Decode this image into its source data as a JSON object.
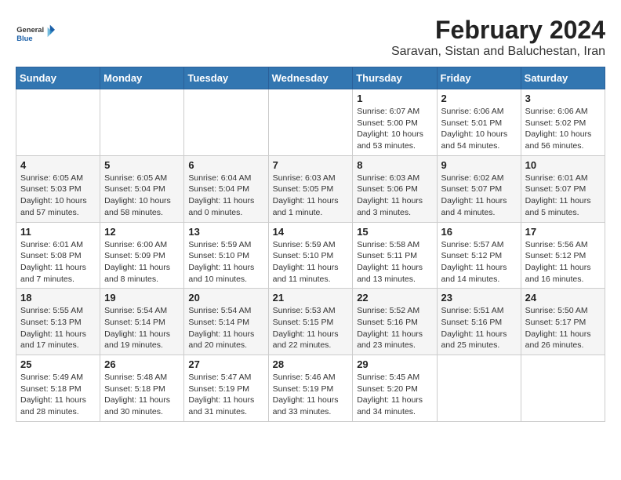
{
  "header": {
    "logo_general": "General",
    "logo_blue": "Blue",
    "month": "February 2024",
    "location": "Saravan, Sistan and Baluchestan, Iran"
  },
  "weekdays": [
    "Sunday",
    "Monday",
    "Tuesday",
    "Wednesday",
    "Thursday",
    "Friday",
    "Saturday"
  ],
  "weeks": [
    [
      {
        "day": "",
        "info": ""
      },
      {
        "day": "",
        "info": ""
      },
      {
        "day": "",
        "info": ""
      },
      {
        "day": "",
        "info": ""
      },
      {
        "day": "1",
        "info": "Sunrise: 6:07 AM\nSunset: 5:00 PM\nDaylight: 10 hours\nand 53 minutes."
      },
      {
        "day": "2",
        "info": "Sunrise: 6:06 AM\nSunset: 5:01 PM\nDaylight: 10 hours\nand 54 minutes."
      },
      {
        "day": "3",
        "info": "Sunrise: 6:06 AM\nSunset: 5:02 PM\nDaylight: 10 hours\nand 56 minutes."
      }
    ],
    [
      {
        "day": "4",
        "info": "Sunrise: 6:05 AM\nSunset: 5:03 PM\nDaylight: 10 hours\nand 57 minutes."
      },
      {
        "day": "5",
        "info": "Sunrise: 6:05 AM\nSunset: 5:04 PM\nDaylight: 10 hours\nand 58 minutes."
      },
      {
        "day": "6",
        "info": "Sunrise: 6:04 AM\nSunset: 5:04 PM\nDaylight: 11 hours\nand 0 minutes."
      },
      {
        "day": "7",
        "info": "Sunrise: 6:03 AM\nSunset: 5:05 PM\nDaylight: 11 hours\nand 1 minute."
      },
      {
        "day": "8",
        "info": "Sunrise: 6:03 AM\nSunset: 5:06 PM\nDaylight: 11 hours\nand 3 minutes."
      },
      {
        "day": "9",
        "info": "Sunrise: 6:02 AM\nSunset: 5:07 PM\nDaylight: 11 hours\nand 4 minutes."
      },
      {
        "day": "10",
        "info": "Sunrise: 6:01 AM\nSunset: 5:07 PM\nDaylight: 11 hours\nand 5 minutes."
      }
    ],
    [
      {
        "day": "11",
        "info": "Sunrise: 6:01 AM\nSunset: 5:08 PM\nDaylight: 11 hours\nand 7 minutes."
      },
      {
        "day": "12",
        "info": "Sunrise: 6:00 AM\nSunset: 5:09 PM\nDaylight: 11 hours\nand 8 minutes."
      },
      {
        "day": "13",
        "info": "Sunrise: 5:59 AM\nSunset: 5:10 PM\nDaylight: 11 hours\nand 10 minutes."
      },
      {
        "day": "14",
        "info": "Sunrise: 5:59 AM\nSunset: 5:10 PM\nDaylight: 11 hours\nand 11 minutes."
      },
      {
        "day": "15",
        "info": "Sunrise: 5:58 AM\nSunset: 5:11 PM\nDaylight: 11 hours\nand 13 minutes."
      },
      {
        "day": "16",
        "info": "Sunrise: 5:57 AM\nSunset: 5:12 PM\nDaylight: 11 hours\nand 14 minutes."
      },
      {
        "day": "17",
        "info": "Sunrise: 5:56 AM\nSunset: 5:12 PM\nDaylight: 11 hours\nand 16 minutes."
      }
    ],
    [
      {
        "day": "18",
        "info": "Sunrise: 5:55 AM\nSunset: 5:13 PM\nDaylight: 11 hours\nand 17 minutes."
      },
      {
        "day": "19",
        "info": "Sunrise: 5:54 AM\nSunset: 5:14 PM\nDaylight: 11 hours\nand 19 minutes."
      },
      {
        "day": "20",
        "info": "Sunrise: 5:54 AM\nSunset: 5:14 PM\nDaylight: 11 hours\nand 20 minutes."
      },
      {
        "day": "21",
        "info": "Sunrise: 5:53 AM\nSunset: 5:15 PM\nDaylight: 11 hours\nand 22 minutes."
      },
      {
        "day": "22",
        "info": "Sunrise: 5:52 AM\nSunset: 5:16 PM\nDaylight: 11 hours\nand 23 minutes."
      },
      {
        "day": "23",
        "info": "Sunrise: 5:51 AM\nSunset: 5:16 PM\nDaylight: 11 hours\nand 25 minutes."
      },
      {
        "day": "24",
        "info": "Sunrise: 5:50 AM\nSunset: 5:17 PM\nDaylight: 11 hours\nand 26 minutes."
      }
    ],
    [
      {
        "day": "25",
        "info": "Sunrise: 5:49 AM\nSunset: 5:18 PM\nDaylight: 11 hours\nand 28 minutes."
      },
      {
        "day": "26",
        "info": "Sunrise: 5:48 AM\nSunset: 5:18 PM\nDaylight: 11 hours\nand 30 minutes."
      },
      {
        "day": "27",
        "info": "Sunrise: 5:47 AM\nSunset: 5:19 PM\nDaylight: 11 hours\nand 31 minutes."
      },
      {
        "day": "28",
        "info": "Sunrise: 5:46 AM\nSunset: 5:19 PM\nDaylight: 11 hours\nand 33 minutes."
      },
      {
        "day": "29",
        "info": "Sunrise: 5:45 AM\nSunset: 5:20 PM\nDaylight: 11 hours\nand 34 minutes."
      },
      {
        "day": "",
        "info": ""
      },
      {
        "day": "",
        "info": ""
      }
    ]
  ]
}
